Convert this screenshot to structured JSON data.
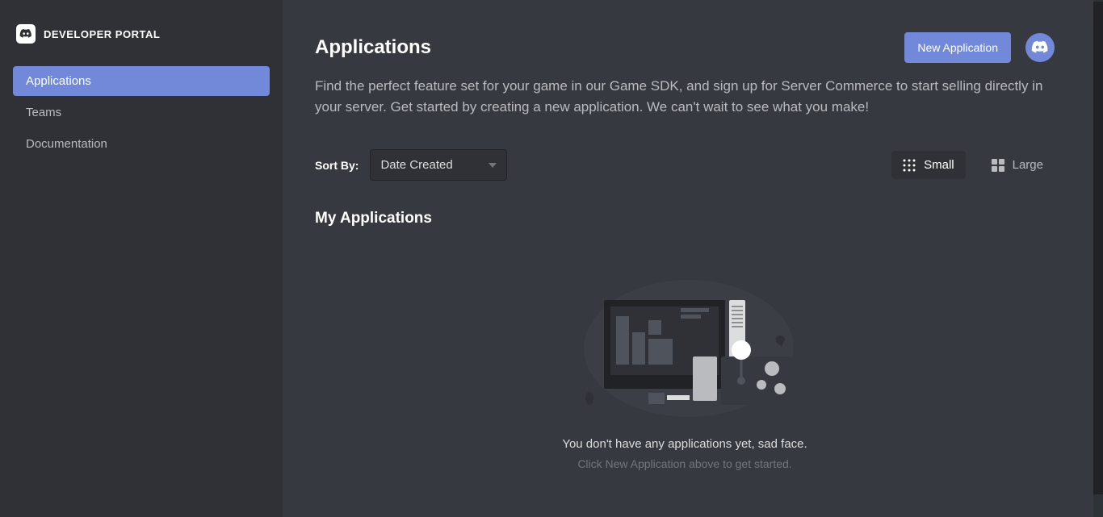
{
  "portal": {
    "title": "DEVELOPER PORTAL"
  },
  "sidebar": {
    "items": [
      {
        "label": "Applications",
        "active": true
      },
      {
        "label": "Teams",
        "active": false
      },
      {
        "label": "Documentation",
        "active": false
      }
    ]
  },
  "header": {
    "title": "Applications",
    "newAppButton": "New Application"
  },
  "description": "Find the perfect feature set for your game in our Game SDK, and sign up for Server Commerce to start selling directly in your server. Get started by creating a new application. We can't wait to see what you make!",
  "sort": {
    "label": "Sort By:",
    "value": "Date Created"
  },
  "viewToggle": {
    "small": "Small",
    "large": "Large"
  },
  "section": {
    "title": "My Applications"
  },
  "emptyState": {
    "text": "You don't have any applications yet, sad face.",
    "subtext": "Click New Application above to get started."
  }
}
